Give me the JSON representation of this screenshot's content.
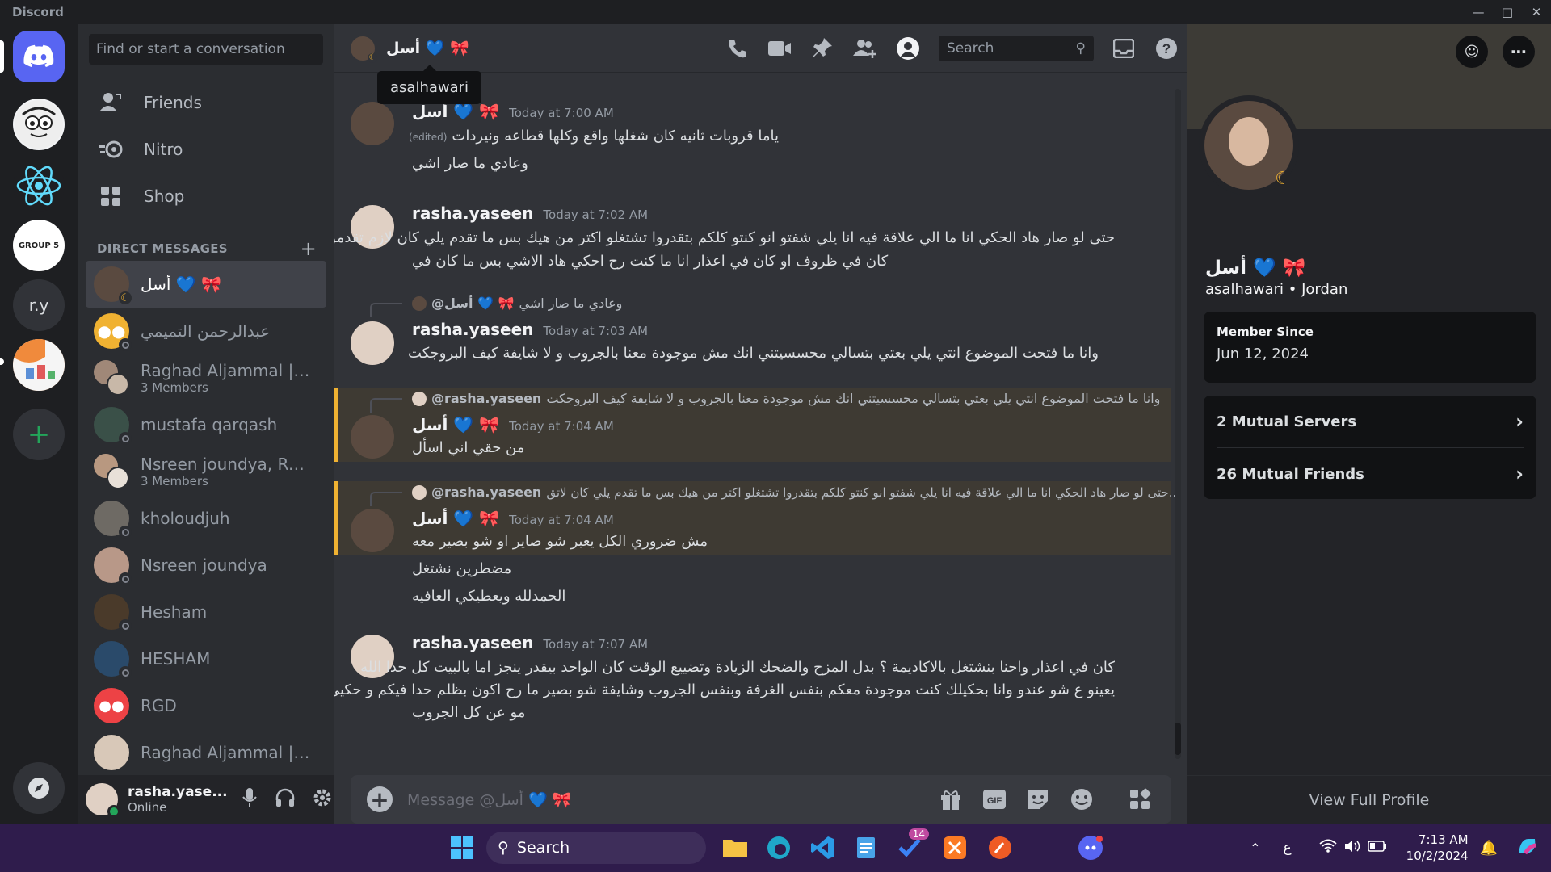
{
  "window": {
    "app_name": "Discord"
  },
  "dm_sidebar": {
    "search_placeholder": "Find or start a conversation",
    "nav": [
      {
        "label": "Friends"
      },
      {
        "label": "Nitro"
      },
      {
        "label": "Shop"
      }
    ],
    "dm_header": "DIRECT MESSAGES",
    "items": [
      {
        "name": "أسل 💙 🎀",
        "sub": ""
      },
      {
        "name": "عبدالرحمن التميمي",
        "sub": ""
      },
      {
        "name": "Raghad Aljammal | Jo...",
        "sub": "3 Members"
      },
      {
        "name": "mustafa qarqash",
        "sub": ""
      },
      {
        "name": "Nsreen joundya, Ragh...",
        "sub": "3 Members"
      },
      {
        "name": "kholoudjuh",
        "sub": ""
      },
      {
        "name": "Nsreen joundya",
        "sub": ""
      },
      {
        "name": "Hesham",
        "sub": ""
      },
      {
        "name": "HESHAM",
        "sub": ""
      },
      {
        "name": "RGD",
        "sub": ""
      },
      {
        "name": "Raghad Aljammal | Jo...",
        "sub": ""
      }
    ]
  },
  "guilds": {
    "items": [
      {
        "label": "r.y"
      },
      {
        "label": "GROUP 5"
      }
    ]
  },
  "user_panel": {
    "name": "rasha.yase...",
    "status": "Online"
  },
  "chat": {
    "recipient": "أسل 💙 🎀",
    "tooltip": "asalhawari",
    "search_placeholder": "Search",
    "composer_placeholder": "Message @أسل 💙 🎀",
    "messages": [
      {
        "author": "أسل 💙 🎀",
        "time": "Today at 7:00 AM",
        "edited": "(edited)",
        "lines": [
          "ياما قروبات ثانيه كان شغلها  واقع وكلها قطاعه ونيردات",
          "وعادي ما صار اشي"
        ]
      },
      {
        "author": "rasha.yaseen",
        "time": "Today at 7:02 AM",
        "lines": [
          "حتى لو صار هاد الحكي انا ما الي علاقة فيه انا يلي شفتو انو كنتو كلكم بتقدروا تشتغلو اكتر من هيك بس ما تقدم يلي كان لازم تقدموا لو",
          "كان في ظروف او كان في اعذار انا ما كنت رح احكي هاد الاشي بس ما كان في"
        ]
      },
      {
        "author": "rasha.yaseen",
        "time": "Today at 7:03 AM",
        "reply_name": "@أسل 💙 🎀",
        "reply_text": "وعادي ما صار اشي",
        "lines": [
          "وانا ما فتحت الموضوع انتي يلي بعتي بتسالي محسسيتني انك مش موجودة معنا بالجروب و لا شايفة كيف البروجكت"
        ]
      },
      {
        "author": "أسل 💙 🎀",
        "time": "Today at 7:04 AM",
        "reply_name": "@rasha.yaseen",
        "reply_text": "وانا ما فتحت الموضوع انتي يلي بعتي بتسالي محسسيتني انك مش موجودة معنا بالجروب و لا شايفة كيف البروجكت",
        "lines": [
          "من حقي اني اسأل"
        ]
      },
      {
        "author": "أسل 💙 🎀",
        "time": "Today at 7:04 AM",
        "reply_name": "@rasha.yaseen",
        "reply_text": "حتى لو صار هاد الحكي انا ما الي علاقة فيه انا يلي شفتو انو كنتو كلكم بتقدروا تشتغلو اكتر من هيك بس ما تقدم يلي كان لاتق...",
        "lines": [
          "مش ضروري الكل يعبر شو صاير او شو بصير معه",
          "مضطرين نشتغل",
          "الحمدلله ويعطيكي العافيه"
        ]
      },
      {
        "author": "rasha.yaseen",
        "time": "Today at 7:07 AM",
        "lines": [
          "كان في اعذار واحنا بنشتغل بالاكاديمة ؟ بدل المزح والضحك الزيادة وتضييع الوقت كان الواحد بيقدر ينجز اما بالبيت كل حدا الله",
          "يعينو ع شو عندو وانا بحكيلك كنت موجودة معكم بنفس الغرفة وبنفس الجروب وشايفة شو بصير ما رح اكون بظلم حدا فيكم و حكيي",
          "مو عن كل الجروب"
        ]
      }
    ]
  },
  "profile": {
    "display_name": "أسل 💙 🎀",
    "username": "asalhawari",
    "location": "Jordan",
    "member_since_label": "Member Since",
    "member_since": "Jun 12, 2024",
    "mutual_servers": "2 Mutual Servers",
    "mutual_friends": "26 Mutual Friends",
    "view_full": "View Full Profile"
  },
  "taskbar": {
    "search": "Search",
    "badge": "14",
    "lang": "ع",
    "time": "7:13 AM",
    "date": "10/2/2024"
  },
  "colors": {
    "blurple": "#5865f2",
    "online": "#23a55a",
    "highlight": "#f0b232"
  }
}
